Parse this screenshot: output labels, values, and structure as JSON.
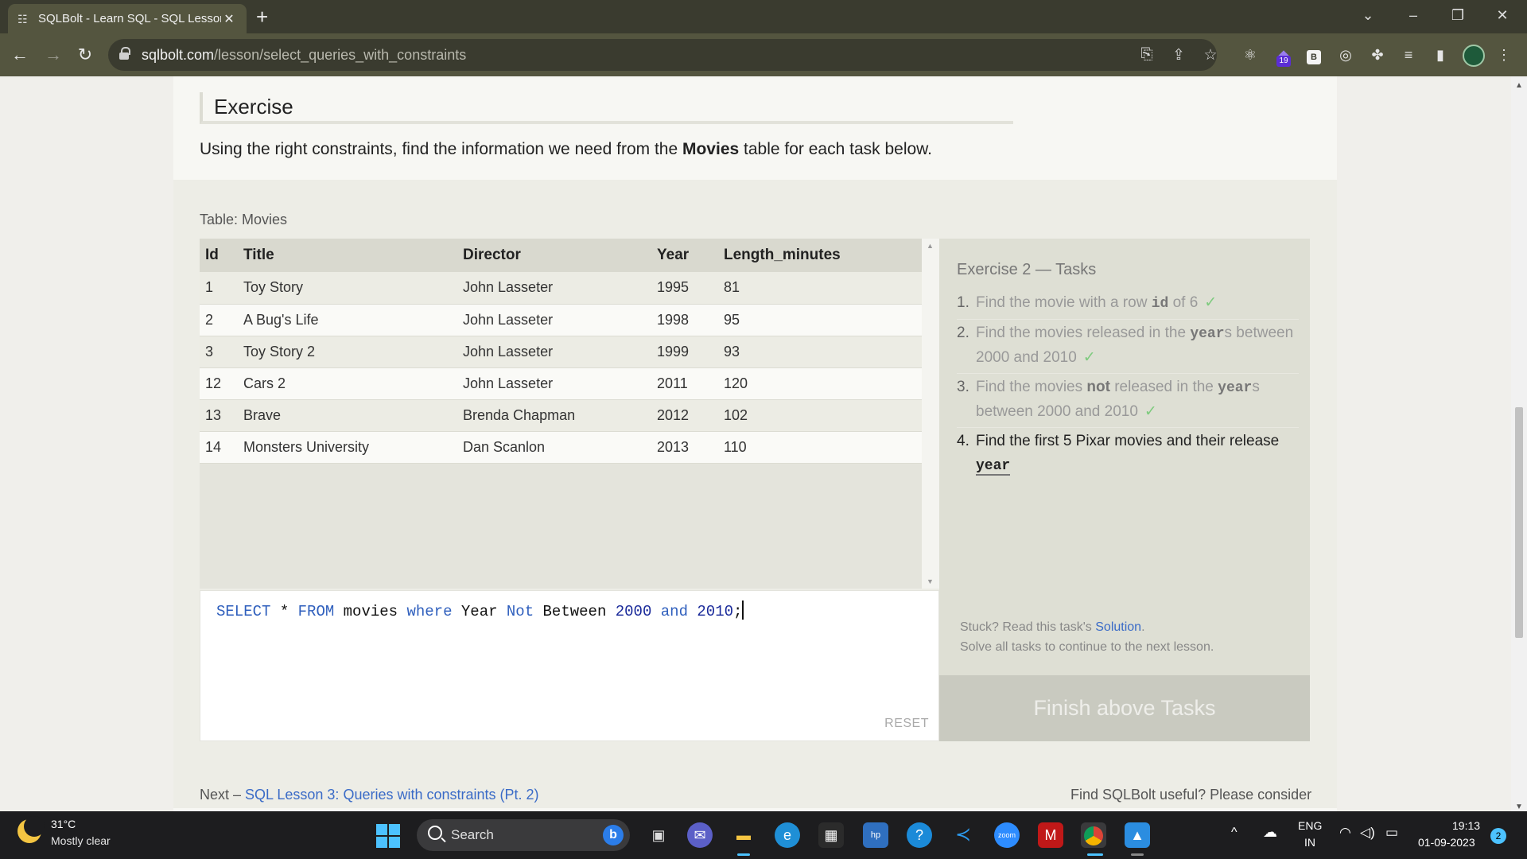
{
  "browser": {
    "tab_title": "SQLBolt - Learn SQL - SQL Lesson",
    "tab_close": "✕",
    "new_tab": "+",
    "url_host": "sqlbolt.com",
    "url_path": "/lesson/select_queries_with_constraints",
    "extension_badge": "19",
    "extension_b_label": "B"
  },
  "page": {
    "exercise_heading": "Exercise",
    "intro_before": "Using the right constraints, find the information we need from the ",
    "intro_bold": "Movies",
    "intro_after": " table for each task below.",
    "table_caption": "Table: Movies",
    "table": {
      "columns": [
        "Id",
        "Title",
        "Director",
        "Year",
        "Length_minutes"
      ],
      "rows": [
        [
          "1",
          "Toy Story",
          "John Lasseter",
          "1995",
          "81"
        ],
        [
          "2",
          "A Bug's Life",
          "John Lasseter",
          "1998",
          "95"
        ],
        [
          "3",
          "Toy Story 2",
          "John Lasseter",
          "1999",
          "93"
        ],
        [
          "12",
          "Cars 2",
          "John Lasseter",
          "2011",
          "120"
        ],
        [
          "13",
          "Brave",
          "Brenda Chapman",
          "2012",
          "102"
        ],
        [
          "14",
          "Monsters University",
          "Dan Scanlon",
          "2013",
          "110"
        ]
      ]
    },
    "editor": {
      "tokens": [
        {
          "t": "SELECT",
          "k": "kw"
        },
        {
          "t": " * ",
          "k": ""
        },
        {
          "t": "FROM",
          "k": "kw"
        },
        {
          "t": " movies ",
          "k": ""
        },
        {
          "t": "where",
          "k": "kw"
        },
        {
          "t": " Year ",
          "k": ""
        },
        {
          "t": "Not",
          "k": "kw"
        },
        {
          "t": " Between ",
          "k": ""
        },
        {
          "t": "2000",
          "k": "num"
        },
        {
          "t": " ",
          "k": ""
        },
        {
          "t": "and",
          "k": "kw"
        },
        {
          "t": " ",
          "k": ""
        },
        {
          "t": "2010",
          "k": "num"
        },
        {
          "t": ";",
          "k": ""
        }
      ],
      "reset_label": "RESET"
    },
    "tasks": {
      "heading": "Exercise 2 — Tasks",
      "t1_num": "1.",
      "t1_a": "Find the movie with a row ",
      "t1_code": "id",
      "t1_b": " of 6",
      "t2_num": "2.",
      "t2_a": "Find the movies released in the ",
      "t2_code": "year",
      "t2_b": "s between 2000 and 2010",
      "t3_num": "3.",
      "t3_a": "Find the movies ",
      "t3_bold": "not",
      "t3_b": " released in the ",
      "t3_code": "year",
      "t3_c": "s between 2000 and 2010",
      "t4_num": "4.",
      "t4_a": "Find the first 5 Pixar movies and their release ",
      "t4_code": "year",
      "check": "✓",
      "help_line1_a": "Stuck? Read this task's ",
      "help_link": "Solution",
      "help_line1_b": ".",
      "help_line2": "Solve all tasks to continue to the next lesson.",
      "finish_label": "Finish above Tasks"
    },
    "next_prefix": "Next – ",
    "next_link": "SQL Lesson 3: Queries with constraints (Pt. 2)",
    "consider_text": "Find SQLBolt useful? Please consider"
  },
  "taskbar": {
    "temp": "31°C",
    "weather": "Mostly clear",
    "search_label": "Search",
    "lang1": "ENG",
    "lang2": "IN",
    "time": "19:13",
    "date": "01-09-2023",
    "notifications": "2"
  }
}
